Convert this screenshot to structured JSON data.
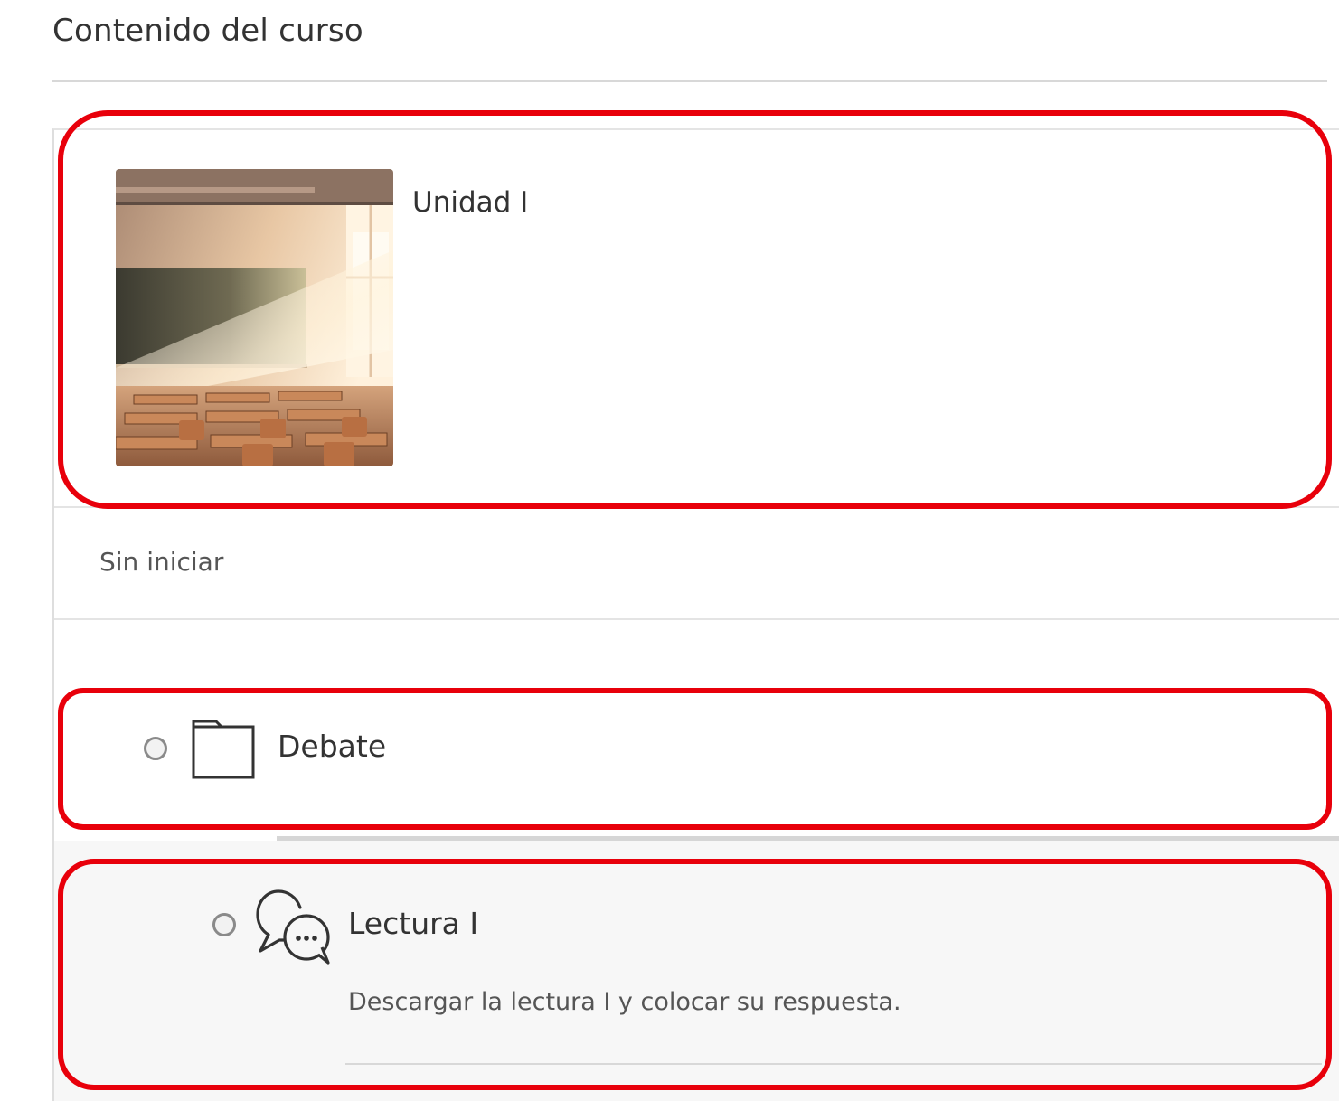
{
  "page": {
    "title": "Contenido del curso"
  },
  "unit": {
    "title": "Unidad I",
    "thumbnail_icon": "classroom-image",
    "status": "Sin iniciar"
  },
  "items": [
    {
      "type": "folder",
      "icon": "folder-icon",
      "label": "Debate"
    },
    {
      "type": "discussion",
      "icon": "chat-bubbles-icon",
      "label": "Lectura I",
      "description": "Descargar la lectura I y colocar su respuesta."
    }
  ],
  "colors": {
    "highlight": "#e8000b",
    "text": "#333333",
    "muted_text": "#555555",
    "nested_background": "#f7f7f7"
  }
}
